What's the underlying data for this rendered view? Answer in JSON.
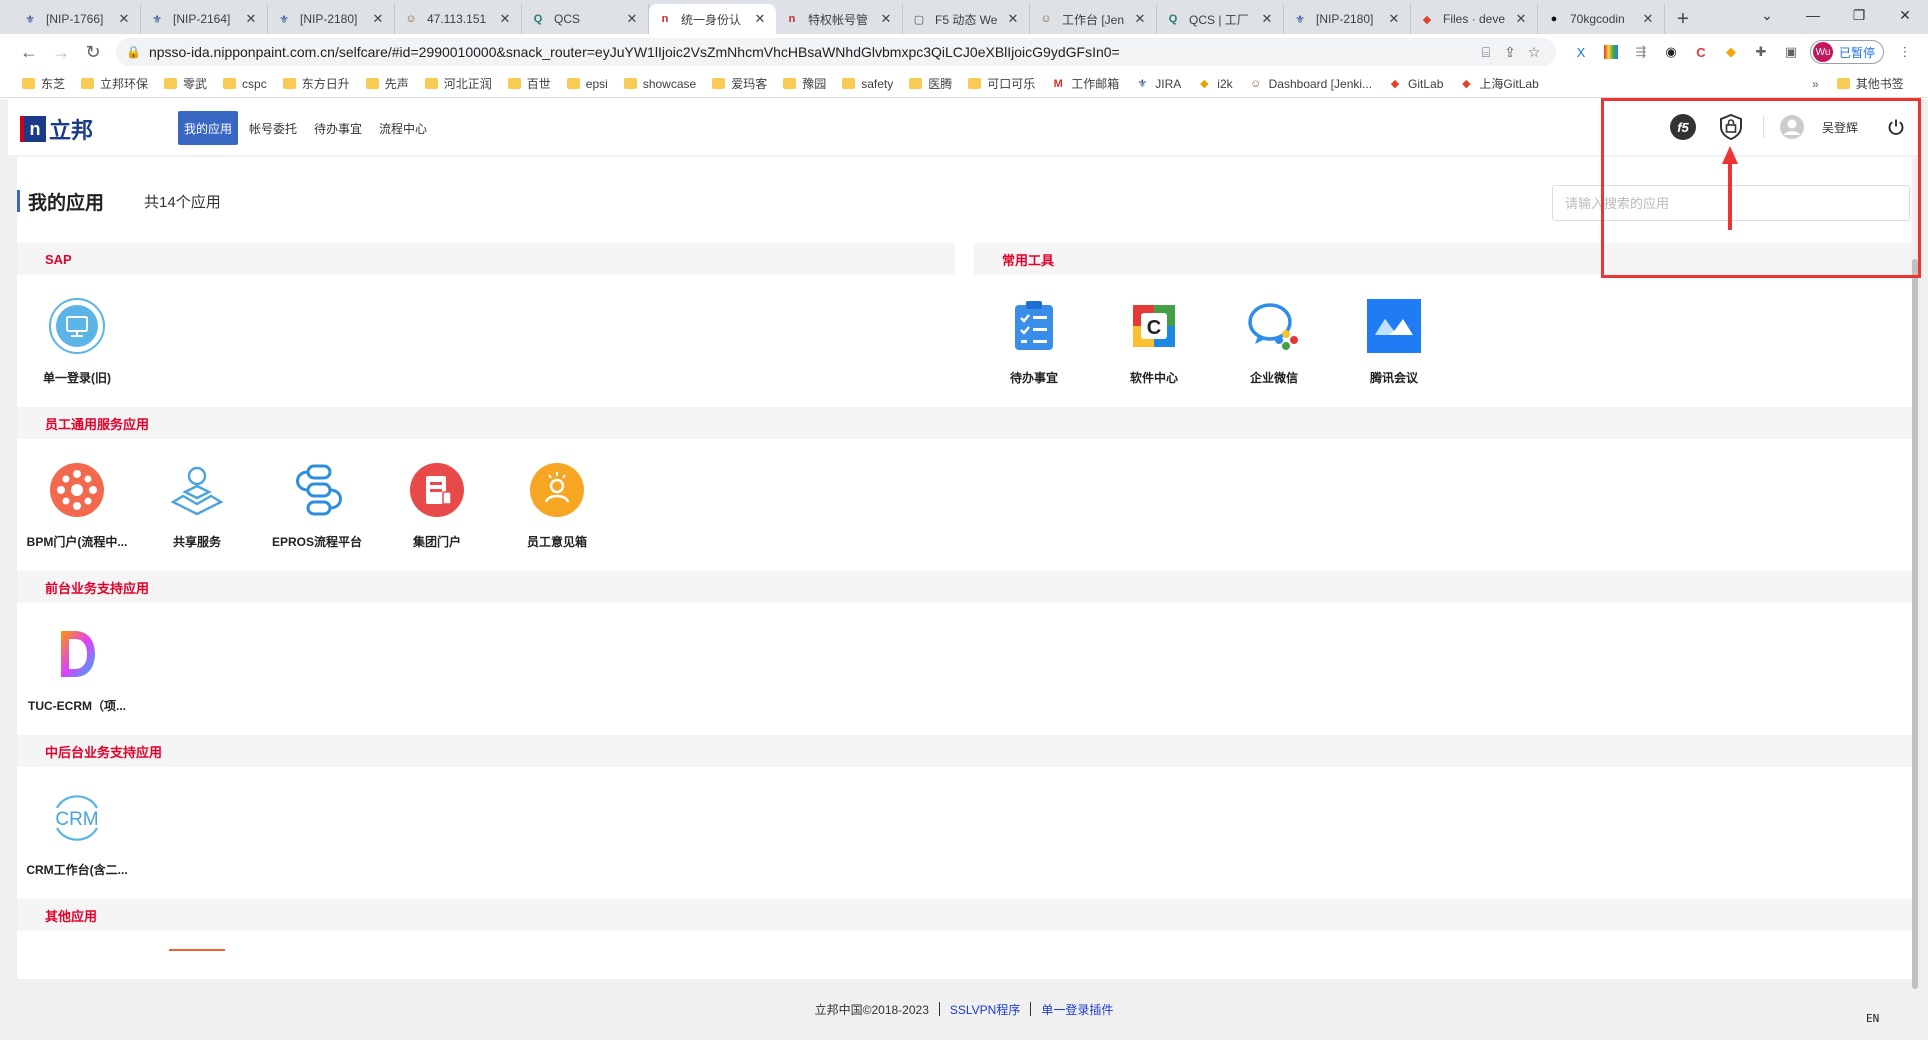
{
  "browser": {
    "tabs": [
      {
        "title": "[NIP-1766]",
        "icon": "jira-icon"
      },
      {
        "title": "[NIP-2164]",
        "icon": "jira-icon"
      },
      {
        "title": "[NIP-2180]",
        "icon": "jira-icon"
      },
      {
        "title": "47.113.151",
        "icon": "jenkins-icon"
      },
      {
        "title": "QCS",
        "icon": "qcs-icon"
      },
      {
        "title": "统一身份认",
        "icon": "nippon-icon",
        "active": true
      },
      {
        "title": "特权帐号管",
        "icon": "nippon-icon"
      },
      {
        "title": "F5 动态 We",
        "icon": "page-icon"
      },
      {
        "title": "工作台 [Jen",
        "icon": "jenkins-icon"
      },
      {
        "title": "QCS | 工厂",
        "icon": "qcs-icon"
      },
      {
        "title": "[NIP-2180]",
        "icon": "jira-icon"
      },
      {
        "title": "Files · deve",
        "icon": "gitlab-icon"
      },
      {
        "title": "70kgcodin",
        "icon": "github-icon"
      }
    ],
    "url": "npsso-ida.nipponpaint.com.cn/selfcare/#id=2990010000&snack_router=eyJuYW1lIjoic2VsZmNhcmVhcHBsaWNhdGlvbmxpc3QiLCJ0eXBlIjoicG9ydGFsIn0=",
    "profile_name": "已暂停",
    "profile_initials": "Wu",
    "bookmarks": [
      {
        "label": "东芝",
        "type": "folder"
      },
      {
        "label": "立邦环保",
        "type": "folder"
      },
      {
        "label": "零武",
        "type": "folder"
      },
      {
        "label": "cspc",
        "type": "folder"
      },
      {
        "label": "东方日升",
        "type": "folder"
      },
      {
        "label": "先声",
        "type": "folder"
      },
      {
        "label": "河北正润",
        "type": "folder"
      },
      {
        "label": "百世",
        "type": "folder"
      },
      {
        "label": "epsi",
        "type": "folder"
      },
      {
        "label": "showcase",
        "type": "folder"
      },
      {
        "label": "爱玛客",
        "type": "folder"
      },
      {
        "label": "豫园",
        "type": "folder"
      },
      {
        "label": "safety",
        "type": "folder"
      },
      {
        "label": "医腾",
        "type": "folder"
      },
      {
        "label": "可口可乐",
        "type": "folder"
      },
      {
        "label": "工作邮箱",
        "type": "gmail"
      },
      {
        "label": "JIRA",
        "type": "jira"
      },
      {
        "label": "i2k",
        "type": "i2k"
      },
      {
        "label": "Dashboard [Jenki...",
        "type": "jenkins"
      },
      {
        "label": "GitLab",
        "type": "gitlab"
      },
      {
        "label": "上海GitLab",
        "type": "gitlab"
      }
    ],
    "other_bookmarks": "其他书签"
  },
  "header": {
    "logo_text": "立邦",
    "logo_mark": "n",
    "nav": [
      "我的应用",
      "帐号委托",
      "待办事宜",
      "流程中心"
    ],
    "user_name": "吴登辉"
  },
  "main": {
    "title": "我的应用",
    "count": "共14个应用",
    "search_placeholder": "请输入搜索的应用"
  },
  "sections": {
    "sap": {
      "title": "SAP",
      "apps": [
        {
          "label": "单一登录(旧)",
          "icon": "monitor-icon"
        }
      ]
    },
    "tools": {
      "title": "常用工具",
      "apps": [
        {
          "label": "待办事宜",
          "icon": "checklist-icon"
        },
        {
          "label": "软件中心",
          "icon": "software-center-icon"
        },
        {
          "label": "企业微信",
          "icon": "wecom-icon"
        },
        {
          "label": "腾讯会议",
          "icon": "tencent-meeting-icon"
        }
      ]
    },
    "employee": {
      "title": "员工通用服务应用",
      "apps": [
        {
          "label": "BPM门户(流程中...",
          "icon": "bpm-icon"
        },
        {
          "label": "共享服务",
          "icon": "shared-service-icon"
        },
        {
          "label": "EPROS流程平台",
          "icon": "epros-icon"
        },
        {
          "label": "集团门户",
          "icon": "portal-icon"
        },
        {
          "label": "员工意见箱",
          "icon": "feedback-icon"
        }
      ]
    },
    "front": {
      "title": "前台业务支持应用",
      "apps": [
        {
          "label": "TUC-ECRM（项...",
          "icon": "tuc-icon"
        }
      ]
    },
    "middle": {
      "title": "中后台业务支持应用",
      "apps": [
        {
          "label": "CRM工作台(含二...",
          "icon": "crm-icon",
          "mark": "CRM"
        }
      ]
    },
    "other": {
      "title": "其他应用"
    }
  },
  "footer": {
    "copyright": "立邦中国©2018-2023",
    "link1": "SSLVPN程序",
    "link2": "单一登录插件"
  },
  "ime": "EN"
}
